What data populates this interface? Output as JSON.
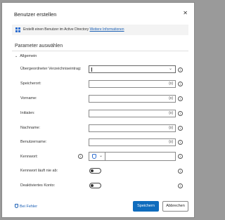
{
  "dialog": {
    "title": "Benutzer erstellen",
    "close_icon": "close-icon"
  },
  "info_bar": {
    "text": "Erstellt einen Benutzer im Active Directory",
    "link": "Weitere Informationen",
    "icon": "windows-icon"
  },
  "section": {
    "title": "Parameter auswählen",
    "group_label": "Allgemein"
  },
  "fields": {
    "parent": {
      "label": "Übergeordneter Verzeichniseintrag:"
    },
    "location": {
      "label": "Speicherort:",
      "suffix": "{x}"
    },
    "firstname": {
      "label": "Vorname:",
      "suffix": "{x}"
    },
    "initials": {
      "label": "Initialen:",
      "suffix": "{x}"
    },
    "lastname": {
      "label": "Nachname:",
      "suffix": "{x}"
    },
    "username": {
      "label": "Benutzername:",
      "suffix": "{x}"
    },
    "password": {
      "label": "Kennwort:"
    },
    "never_expires": {
      "label": "Kennwort läuft nie ab:",
      "value": false
    },
    "disabled": {
      "label": "Deaktiviertes Konto:",
      "value": false
    }
  },
  "footer": {
    "help": "Bei Fehler",
    "save": "Speichern",
    "cancel": "Abbrechen"
  },
  "colors": {
    "primary": "#0f6cbd",
    "link": "#1a5fb4"
  }
}
